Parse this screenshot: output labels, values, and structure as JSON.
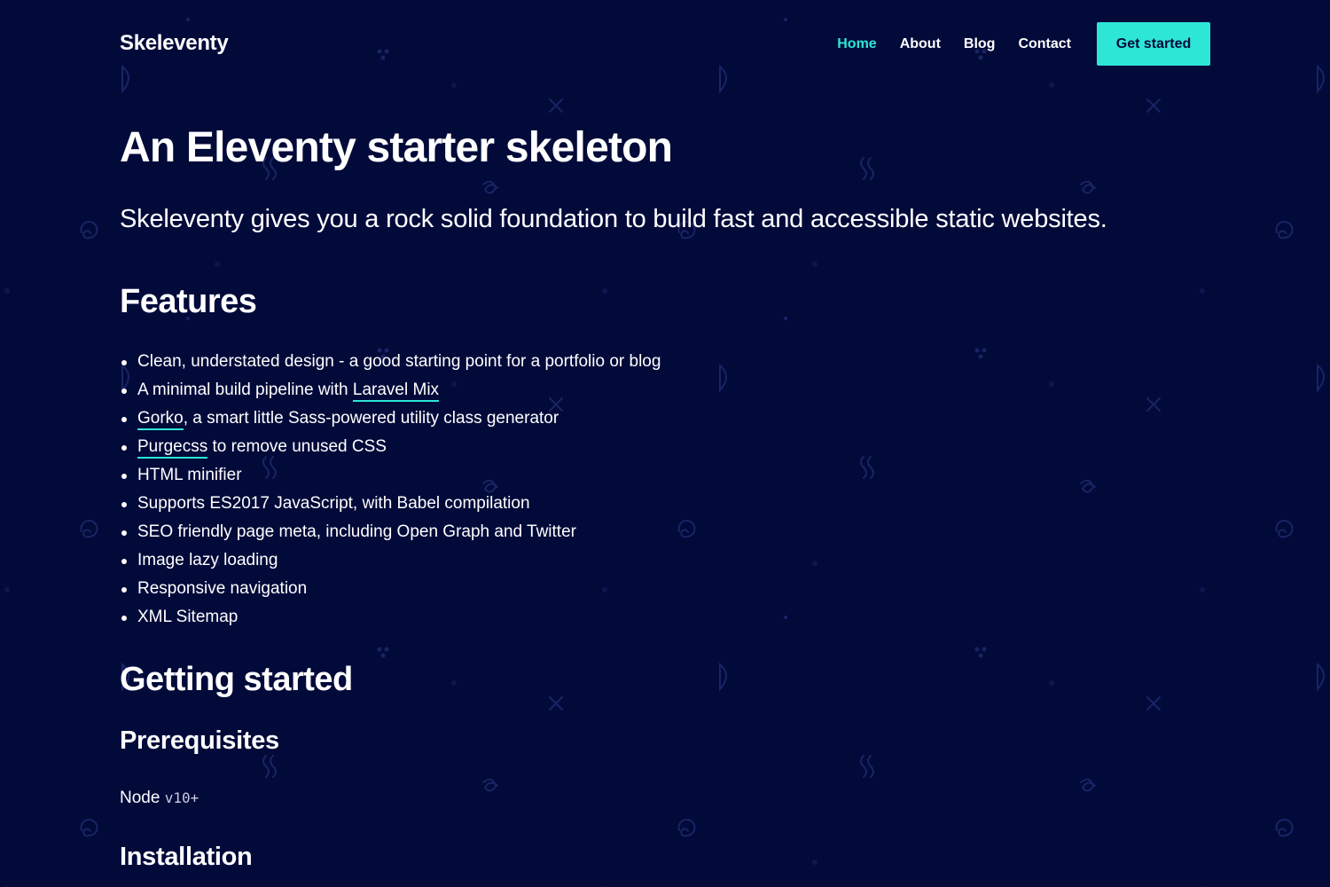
{
  "header": {
    "brand": "Skeleventy",
    "nav": [
      {
        "label": "Home",
        "active": true
      },
      {
        "label": "About",
        "active": false
      },
      {
        "label": "Blog",
        "active": false
      },
      {
        "label": "Contact",
        "active": false
      }
    ],
    "cta_label": "Get started"
  },
  "hero": {
    "title": "An Eleventy starter skeleton",
    "lead": "Skeleventy gives you a rock solid foundation to build fast and accessible static websites."
  },
  "features": {
    "heading": "Features",
    "items": [
      {
        "before": "Clean, understated design - a good starting point for a portfolio or blog",
        "link": "",
        "after": ""
      },
      {
        "before": "A minimal build pipeline with ",
        "link": "Laravel Mix",
        "after": ""
      },
      {
        "before": "",
        "link": "Gorko",
        "after": ", a smart little Sass-powered utility class generator"
      },
      {
        "before": "",
        "link": "Purgecss",
        "after": " to remove unused CSS"
      },
      {
        "before": "HTML minifier",
        "link": "",
        "after": ""
      },
      {
        "before": "Supports ES2017 JavaScript, with Babel compilation",
        "link": "",
        "after": ""
      },
      {
        "before": "SEO friendly page meta, including Open Graph and Twitter",
        "link": "",
        "after": ""
      },
      {
        "before": "Image lazy loading",
        "link": "",
        "after": ""
      },
      {
        "before": "Responsive navigation",
        "link": "",
        "after": ""
      },
      {
        "before": "XML Sitemap",
        "link": "",
        "after": ""
      }
    ]
  },
  "getting_started": {
    "heading": "Getting started",
    "prerequisites_heading": "Prerequisites",
    "prerequisite_text": "Node ",
    "prerequisite_code": "v10+",
    "installation_heading": "Installation"
  },
  "colors": {
    "background": "#020a3a",
    "accent": "#2ee6d6",
    "text": "#ffffff"
  }
}
